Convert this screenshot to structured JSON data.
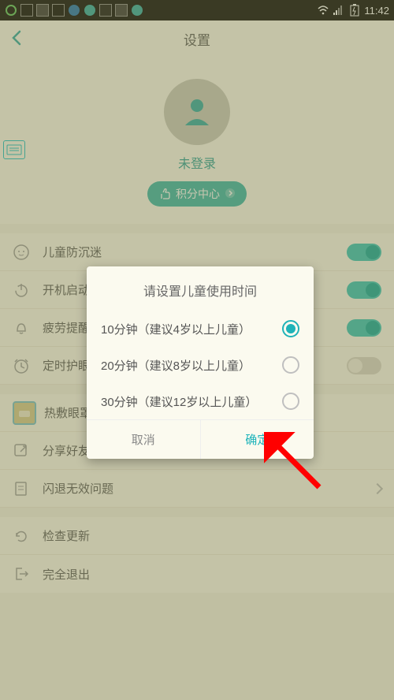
{
  "statusbar": {
    "time": "11:42"
  },
  "appbar": {
    "title": "设置"
  },
  "profile": {
    "login_status": "未登录",
    "points_label": "积分中心"
  },
  "settings": {
    "group1": [
      {
        "label": "儿童防沉迷",
        "toggle": true
      },
      {
        "label": "开机启动",
        "toggle": true
      },
      {
        "label": "疲劳提醒",
        "toggle": true
      },
      {
        "label": "定时护眼",
        "toggle": false
      }
    ],
    "group2": [
      {
        "label": "热敷眼罩"
      },
      {
        "label": "分享好友"
      },
      {
        "label": "闪退无效问题"
      }
    ],
    "group3": [
      {
        "label": "检查更新"
      },
      {
        "label": "完全退出"
      }
    ]
  },
  "dialog": {
    "title": "请设置儿童使用时间",
    "options": [
      {
        "label": "10分钟（建议4岁以上儿童）",
        "selected": true
      },
      {
        "label": "20分钟（建议8岁以上儿童）",
        "selected": false
      },
      {
        "label": "30分钟（建议12岁以上儿童）",
        "selected": false
      }
    ],
    "cancel": "取消",
    "ok": "确定"
  }
}
